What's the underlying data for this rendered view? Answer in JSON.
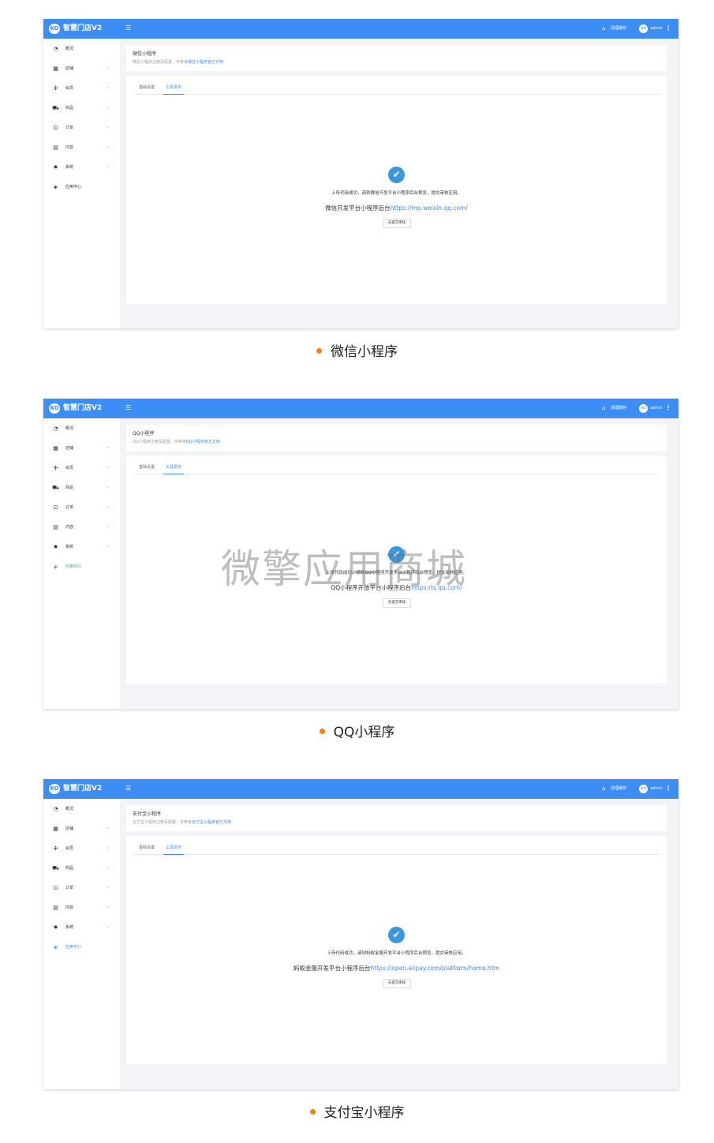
{
  "app": {
    "brand": "智慧门店V2",
    "logo_text": "KO",
    "clear_cache": "清理缓存",
    "user": "admin",
    "avatar_text": "ad"
  },
  "sidebar": {
    "items": [
      {
        "label": "概况",
        "icon": "dashboard-icon",
        "glyph": "◔",
        "arrow": ""
      },
      {
        "label": "店铺",
        "icon": "grid-icon",
        "glyph": "▦",
        "arrow": "›"
      },
      {
        "label": "会员",
        "icon": "users-icon",
        "glyph": "✣",
        "arrow": "›"
      },
      {
        "label": "商品",
        "icon": "cart-icon",
        "glyph": "⛟",
        "arrow": "›"
      },
      {
        "label": "订单",
        "icon": "order-icon",
        "glyph": "⊡",
        "arrow": "›"
      },
      {
        "label": "内容",
        "icon": "document-icon",
        "glyph": "▤",
        "arrow": "›"
      },
      {
        "label": "系统",
        "icon": "gear-icon",
        "glyph": "✹",
        "arrow": "›"
      },
      {
        "label": "应用中心",
        "icon": "cube-icon",
        "glyph": "◈",
        "arrow": ""
      }
    ]
  },
  "tabs": [
    "基础设置",
    "工具发布"
  ],
  "panels": [
    {
      "title": "微信小程序",
      "desc_prefix": "微信小程序注册及配置，可参考",
      "desc_link": "微信小程序官方文档",
      "message": "上传代码成功，请到微信开发平台小程序后台预览，提交审核应用。",
      "platform_label": "微信开发平台小程序后台",
      "platform_url": "https://mp.weixin.qq.com/",
      "button": "去提交审核",
      "active_nav": -1,
      "caption": "微信小程序"
    },
    {
      "title": "QQ小程序",
      "desc_prefix": "QQ小程序注册及配置，可参考",
      "desc_link": "QQ小程序官方文档",
      "message": "上传代码成功，请到QQ小程序开放平台小程序后台预览，提交审核应用。",
      "platform_label": "QQ小程序开放平台小程序后台",
      "platform_url": "https://q.qq.com/",
      "button": "去提交审核",
      "active_nav": 7,
      "caption": "QQ小程序"
    },
    {
      "title": "支付宝小程序",
      "desc_prefix": "支付宝小程序注册及配置，可参考",
      "desc_link": "支付宝小程序官方文档",
      "message": "上传代码成功，请到蚂蚁金服开发平台小程序后台预览，提交审核应用。",
      "platform_label": "蚂蚁金服开发平台小程序后台",
      "platform_url": "https://open.alipay.com/platform/home.htm",
      "button": "去提交审核",
      "active_nav": 7,
      "caption": "支付宝小程序"
    }
  ],
  "watermark": "微擎应用商城",
  "colors": {
    "primary": "#3d8ef4",
    "success": "#3b97dd",
    "bullet": "#ff7d12"
  }
}
